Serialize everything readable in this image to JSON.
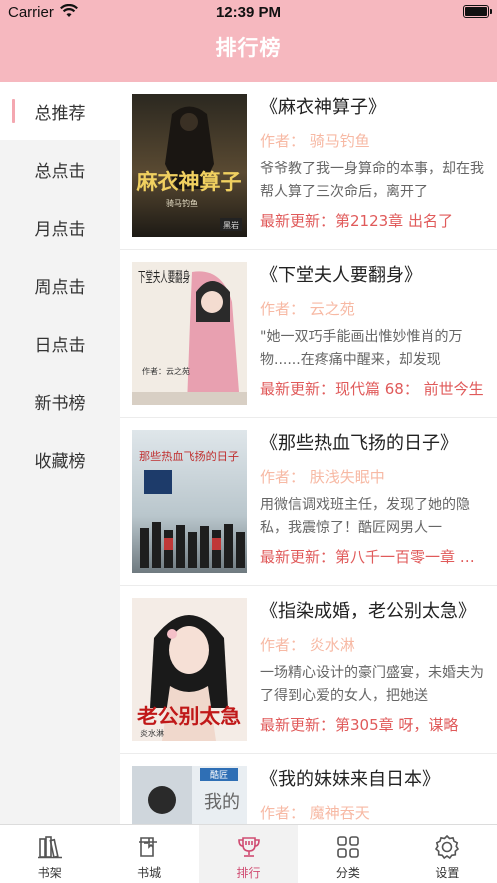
{
  "status_bar": {
    "carrier": "Carrier",
    "time": "12:39 PM"
  },
  "nav": {
    "title": "排行榜"
  },
  "colors": {
    "header_bg": "#f6b8bf",
    "accent": "#f4a7b0",
    "author": "#f7b9a4",
    "update": "#e05a5a",
    "tab_active": "#d04c72"
  },
  "sidebar": {
    "items": [
      {
        "label": "总推荐",
        "active": true
      },
      {
        "label": "总点击",
        "active": false
      },
      {
        "label": "月点击",
        "active": false
      },
      {
        "label": "周点击",
        "active": false
      },
      {
        "label": "日点击",
        "active": false
      },
      {
        "label": "新书榜",
        "active": false
      },
      {
        "label": "收藏榜",
        "active": false
      }
    ]
  },
  "books": [
    {
      "title": "《麻衣神算子》",
      "author": "作者：  骑马钓鱼",
      "desc": "爷爷教了我一身算命的本事，却在我帮人算了三次命后，离开了",
      "update": "最新更新：第2123章 出名了",
      "cover_text": "麻衣神算子",
      "cover_sub": "骑马钓鱼",
      "cover_badge": "黑岩"
    },
    {
      "title": "《下堂夫人要翻身》",
      "author": "作者：  云之苑",
      "desc": "\"她一双巧手能画出惟妙惟肖的万物......在疼痛中醒来，却发现",
      "update": "最新更新：现代篇 68： 前世今生",
      "cover_text": "下堂夫人要翻身",
      "cover_sub": "作者：云之苑"
    },
    {
      "title": "《那些热血飞扬的日子》",
      "author": "作者：  肤浅失眠中",
      "desc": "用微信调戏班主任，发现了她的隐私，我震惊了！酷匠网男人一",
      "update": "最新更新：第八千一百零一章 热血",
      "cover_text": "那些热血飞扬的日子"
    },
    {
      "title": "《指染成婚，老公别太急》",
      "author": "作者：  炎水淋",
      "desc": "一场精心设计的豪门盛宴，未婚夫为了得到心爱的女人，把她送",
      "update": "最新更新：第305章 呀，谋略",
      "cover_text": "老公别太急",
      "cover_sub": "炎水淋"
    },
    {
      "title": "《我的妹妹来自日本》",
      "author": "作者：  魔神吞天",
      "desc": "",
      "update": "",
      "cover_text": "我的",
      "cover_badge": "酷匠"
    }
  ],
  "tabbar": {
    "items": [
      {
        "label": "书架",
        "icon": "bookshelf-icon",
        "active": false
      },
      {
        "label": "书城",
        "icon": "bookstore-icon",
        "active": false
      },
      {
        "label": "排行",
        "icon": "trophy-icon",
        "active": true
      },
      {
        "label": "分类",
        "icon": "category-icon",
        "active": false
      },
      {
        "label": "设置",
        "icon": "gear-icon",
        "active": false
      }
    ]
  }
}
